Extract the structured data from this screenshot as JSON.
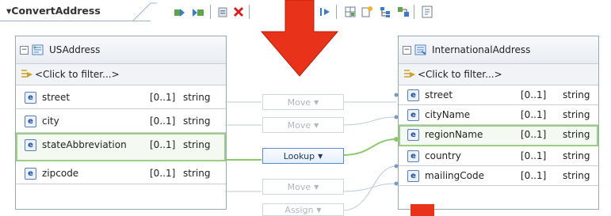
{
  "title": "▾ConvertAddress",
  "colors": {
    "arrow": "#e8321a",
    "link": "#7a9cc4",
    "active_link": "#8cc96a"
  },
  "source": {
    "name": "USAddress",
    "filter": "<Click to filter...>",
    "fields": [
      {
        "name": "street",
        "card": "[0..1]",
        "type": "string"
      },
      {
        "name": "city",
        "card": "[0..1]",
        "type": "string"
      },
      {
        "name": "stateAbbreviation",
        "card": "[0..1]",
        "type": "string"
      },
      {
        "name": "zipcode",
        "card": "[0..1]",
        "type": "string"
      }
    ]
  },
  "target": {
    "name": "InternationalAddress",
    "filter": "<Click to filter...>",
    "fields": [
      {
        "name": "street",
        "card": "[0..1]",
        "type": "string"
      },
      {
        "name": "cityName",
        "card": "[0..1]",
        "type": "string"
      },
      {
        "name": "regionName",
        "card": "[0..1]",
        "type": "string"
      },
      {
        "name": "country",
        "card": "[0..1]",
        "type": "string"
      },
      {
        "name": "mailingCode",
        "card": "[0..1]",
        "type": "string"
      }
    ]
  },
  "transforms": [
    {
      "label": "Move"
    },
    {
      "label": "Move"
    },
    {
      "label": "Lookup"
    },
    {
      "label": "Move"
    },
    {
      "label": "Assign"
    }
  ],
  "element_marker": "e"
}
